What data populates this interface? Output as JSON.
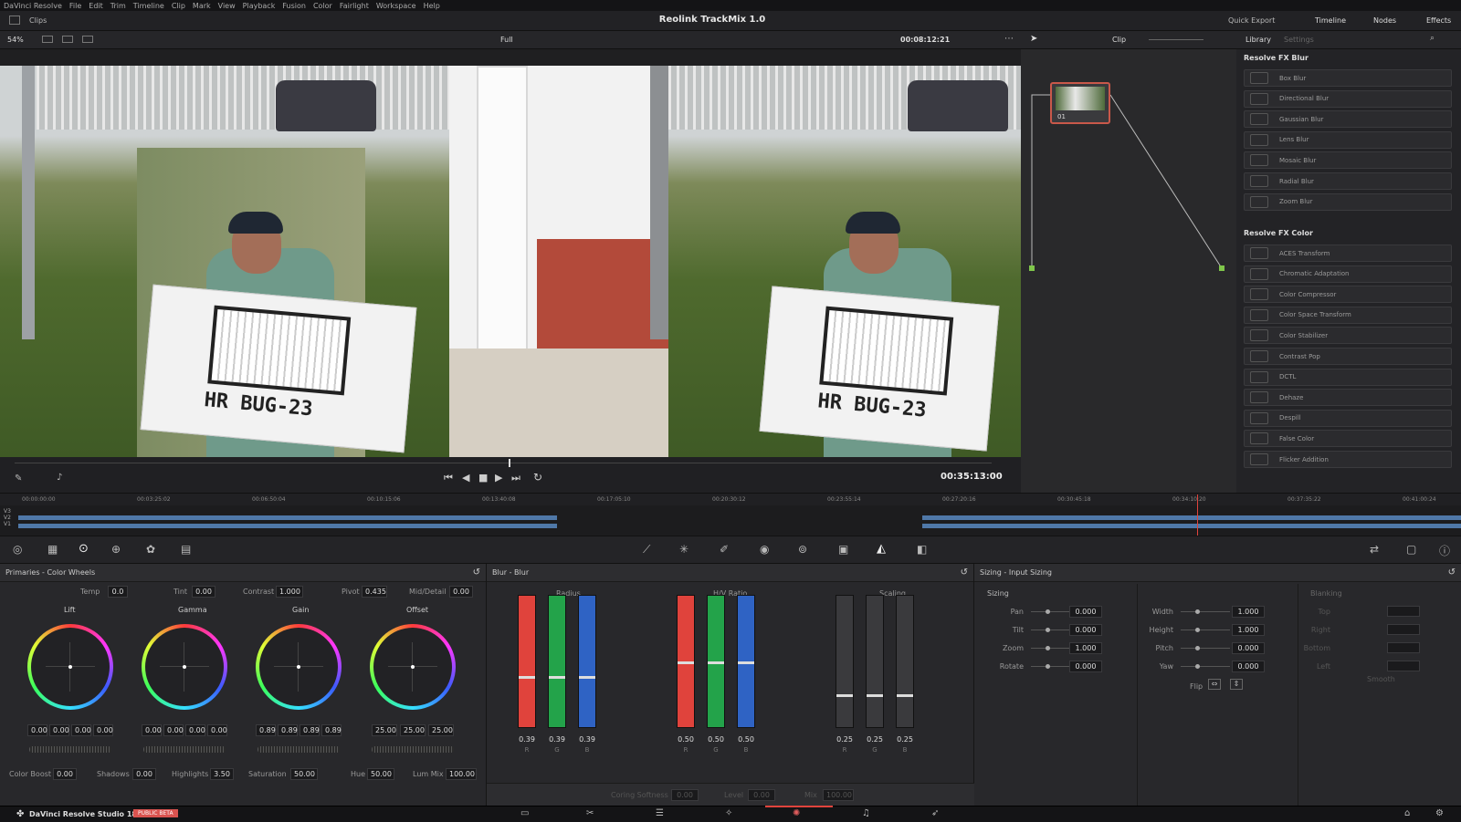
{
  "app": {
    "name": "DaVinci Resolve"
  },
  "menu": [
    "DaVinci Resolve",
    "File",
    "Edit",
    "Trim",
    "Timeline",
    "Clip",
    "Mark",
    "View",
    "Playback",
    "Fusion",
    "Color",
    "Fairlight",
    "Workspace",
    "Help"
  ],
  "header": {
    "clips_label": "Clips",
    "project_title": "Reolink TrackMix 1.0",
    "quick_export": "Quick Export",
    "timeline": "Timeline",
    "nodes": "Nodes",
    "effects": "Effects"
  },
  "viewer": {
    "zoom": "54%",
    "quality": "Full",
    "timecode": "00:08:12:21",
    "clip_label": "Clip",
    "duration": "00:35:13:00",
    "sign_text": "HR BUG-23",
    "sign_letters": "HR",
    "sign_plate": "BUG-23"
  },
  "node": {
    "label": "01"
  },
  "library": {
    "tab_library": "Library",
    "tab_settings": "Settings",
    "blur_title": "Resolve FX Blur",
    "blur_items": [
      "Box Blur",
      "Directional Blur",
      "Gaussian Blur",
      "Lens Blur",
      "Mosaic Blur",
      "Radial Blur",
      "Zoom Blur"
    ],
    "color_title": "Resolve FX Color",
    "color_items": [
      "ACES Transform",
      "Chromatic Adaptation",
      "Color Compressor",
      "Color Space Transform",
      "Color Stabilizer",
      "Contrast Pop",
      "DCTL",
      "Dehaze",
      "Despill",
      "False Color",
      "Flicker Addition"
    ]
  },
  "ruler": [
    "00:00:00:00",
    "00:03:25:02",
    "00:06:50:04",
    "00:10:15:06",
    "00:13:40:08",
    "00:17:05:10",
    "00:20:30:12",
    "00:23:55:14",
    "00:27:20:16",
    "00:30:45:18",
    "00:34:10:20",
    "00:37:35:22",
    "00:41:00:24"
  ],
  "tracks": [
    "V3",
    "V2",
    "V1"
  ],
  "primaries": {
    "title": "Primaries - Color Wheels",
    "temp_label": "Temp",
    "temp": "0.0",
    "tint_label": "Tint",
    "tint": "0.00",
    "contrast_label": "Contrast",
    "contrast": "1.000",
    "pivot_label": "Pivot",
    "pivot": "0.435",
    "middetail_label": "Mid/Detail",
    "middetail": "0.00",
    "wheels": [
      {
        "name": "Lift",
        "values": [
          "0.00",
          "0.00",
          "0.00",
          "0.00"
        ]
      },
      {
        "name": "Gamma",
        "values": [
          "0.00",
          "0.00",
          "0.00",
          "0.00"
        ]
      },
      {
        "name": "Gain",
        "values": [
          "0.89",
          "0.89",
          "0.89",
          "0.89"
        ]
      },
      {
        "name": "Offset",
        "values": [
          "25.00",
          "25.00",
          "25.00"
        ]
      }
    ],
    "colorboost_label": "Color Boost",
    "colorboost": "0.00",
    "shadows_label": "Shadows",
    "shadows": "0.00",
    "highlights_label": "Highlights",
    "highlights": "3.50",
    "saturation_label": "Saturation",
    "saturation": "50.00",
    "hue_label": "Hue",
    "hue": "50.00",
    "lummix_label": "Lum Mix",
    "lummix": "100.00"
  },
  "blur": {
    "title": "Blur - Blur",
    "radius_label": "Radius",
    "radius": [
      "0.39",
      "0.39",
      "0.39"
    ],
    "radius_level": 0.39,
    "hv_label": "H/V Ratio",
    "hv": [
      "0.50",
      "0.50",
      "0.50"
    ],
    "hv_level": 0.5,
    "scaling_label": "Scaling",
    "scaling": [
      "0.25",
      "0.25",
      "0.25"
    ],
    "scaling_level": 0.25,
    "rgb": [
      "R",
      "G",
      "B"
    ],
    "coring_label": "Coring Softness",
    "coring": "0.00",
    "level_label": "Level",
    "level": "0.00",
    "mix_label": "Mix",
    "mix": "100.00"
  },
  "sizing": {
    "title": "Sizing - Input Sizing",
    "section": "Sizing",
    "blanking": "Blanking",
    "left": [
      {
        "label": "Pan",
        "value": "0.000"
      },
      {
        "label": "Tilt",
        "value": "0.000"
      },
      {
        "label": "Zoom",
        "value": "1.000"
      },
      {
        "label": "Rotate",
        "value": "0.000"
      }
    ],
    "right": [
      {
        "label": "Width",
        "value": "1.000"
      },
      {
        "label": "Height",
        "value": "1.000"
      },
      {
        "label": "Pitch",
        "value": "0.000"
      },
      {
        "label": "Yaw",
        "value": "0.000"
      }
    ],
    "flip_label": "Flip",
    "blank": [
      "Top",
      "Right",
      "Bottom",
      "Left"
    ],
    "smooth": "Smooth"
  },
  "footer": {
    "app": "DaVinci Resolve Studio 18.5",
    "badge": "PUBLIC BETA"
  }
}
